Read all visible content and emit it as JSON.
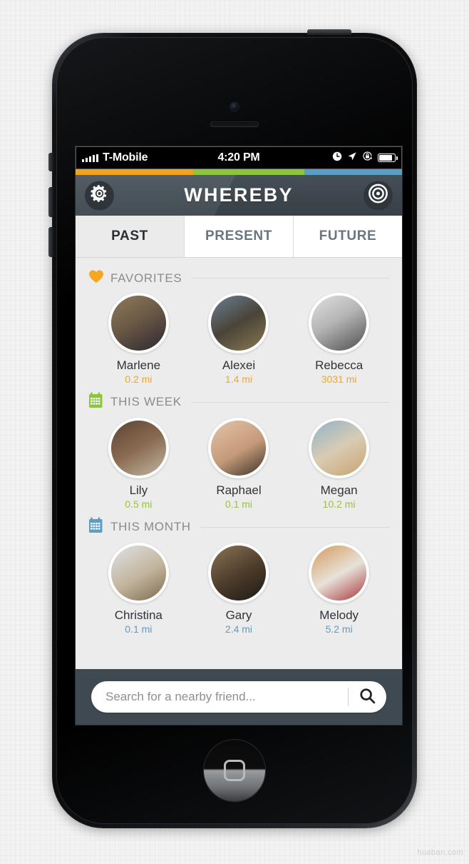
{
  "statusbar": {
    "carrier": "T-Mobile",
    "time": "4:20 PM",
    "icons": [
      "clock-icon",
      "location-arrow-icon",
      "rotation-lock-icon",
      "battery-icon"
    ]
  },
  "stripe": {
    "colors": [
      "#f0a31e",
      "#8cc63f",
      "#5b9dc4"
    ]
  },
  "navbar": {
    "title": "WHEREBY",
    "left_icon": "gear-icon",
    "right_icon": "target-icon"
  },
  "tabs": [
    {
      "label": "PAST",
      "active": true
    },
    {
      "label": "PRESENT",
      "active": false
    },
    {
      "label": "FUTURE",
      "active": false
    }
  ],
  "sections": [
    {
      "title": "FAVORITES",
      "icon": "heart-icon",
      "icon_color": "#f5a623",
      "distance_color": "#f5a623",
      "people": [
        {
          "name": "Marlene",
          "distance": "0.2 mi",
          "avatar_colors": [
            "#6d5a47",
            "#2d2a33"
          ]
        },
        {
          "name": "Alexei",
          "distance": "1.4 mi",
          "avatar_colors": [
            "#5f7286",
            "#8a7a53"
          ]
        },
        {
          "name": "Rebecca",
          "distance": "3031 mi",
          "avatar_colors": [
            "#cfcfcf",
            "#5e5e5e"
          ]
        }
      ]
    },
    {
      "title": "THIS WEEK",
      "icon": "calendar-icon",
      "icon_color": "#8cc63f",
      "distance_color": "#9ac23c",
      "people": [
        {
          "name": "Lily",
          "distance": "0.5 mi",
          "avatar_colors": [
            "#4a3a2e",
            "#9c7d63"
          ]
        },
        {
          "name": "Raphael",
          "distance": "0.1 mi",
          "avatar_colors": [
            "#d6b79c",
            "#3b3127"
          ]
        },
        {
          "name": "Megan",
          "distance": "10.2 mi",
          "avatar_colors": [
            "#7fa0b5",
            "#c8a36f"
          ]
        }
      ]
    },
    {
      "title": "THIS MONTH",
      "icon": "calendar-icon",
      "icon_color": "#5b9dc4",
      "distance_color": "#5b9dc4",
      "people": [
        {
          "name": "Christina",
          "distance": "0.1 mi",
          "avatar_colors": [
            "#c9cdd2",
            "#8e7a63"
          ]
        },
        {
          "name": "Gary",
          "distance": "2.4 mi",
          "avatar_colors": [
            "#6e5a44",
            "#241f1b"
          ]
        },
        {
          "name": "Melody",
          "distance": "5.2 mi",
          "avatar_colors": [
            "#c4864a",
            "#a8343a"
          ]
        }
      ]
    }
  ],
  "search": {
    "value": "",
    "placeholder": "Search for a nearby friend...",
    "button_icon": "search-icon"
  },
  "watermark": "huaban.com"
}
